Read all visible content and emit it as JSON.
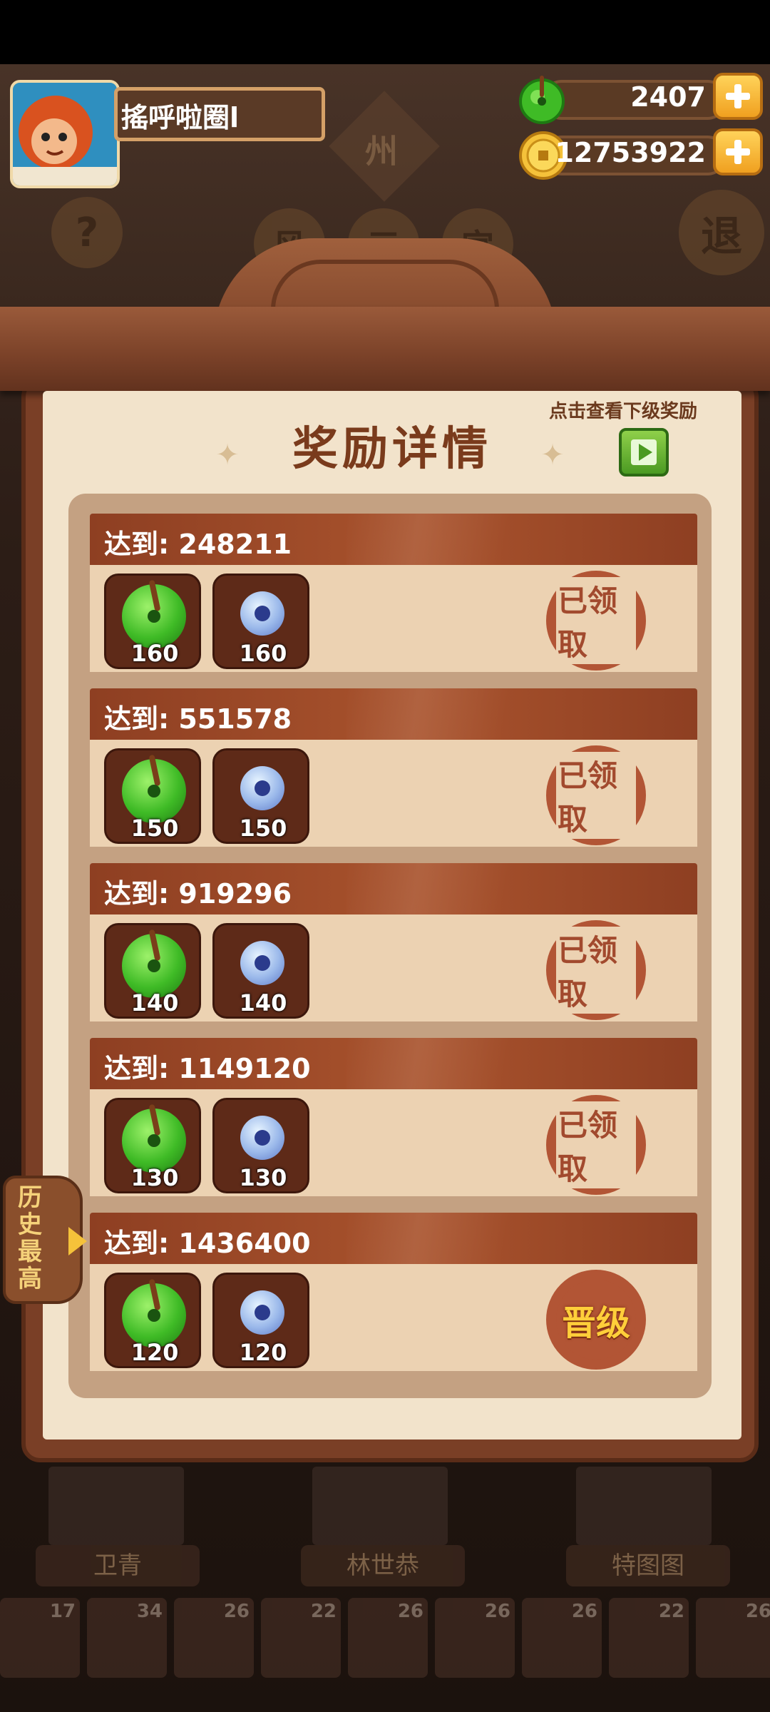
{
  "player": {
    "name": "搖呼啦圈l"
  },
  "currency": {
    "jade": "2407",
    "coins": "12753922"
  },
  "background": {
    "region": "州",
    "help_icon": "?",
    "exit_label": "退",
    "tabs": [
      "风",
      "三",
      "宫"
    ],
    "characters": [
      "卫青",
      "林世恭",
      "特图图"
    ],
    "food_counts": [
      "17",
      "34",
      "26",
      "22",
      "26",
      "26",
      "26",
      "22",
      "26"
    ]
  },
  "panel": {
    "title": "奖励详情",
    "hint": "点击查看下级奖励",
    "side_tab": "历史最高"
  },
  "rewards": [
    {
      "label": "达到: 248211",
      "jade": "160",
      "disc": "160",
      "status": "已领取"
    },
    {
      "label": "达到: 551578",
      "jade": "150",
      "disc": "150",
      "status": "已领取"
    },
    {
      "label": "达到: 919296",
      "jade": "140",
      "disc": "140",
      "status": "已领取"
    },
    {
      "label": "达到: 1149120",
      "jade": "130",
      "disc": "130",
      "status": "已领取"
    },
    {
      "label": "达到: 1436400",
      "jade": "120",
      "disc": "120",
      "status": "晋级"
    }
  ],
  "icons": {
    "jade": "green-jade-pendant-icon",
    "disc": "blue-jade-disc-icon",
    "coin": "gold-coin-icon",
    "plus": "plus-icon",
    "next": "play-arrow-icon"
  },
  "colors": {
    "accent": "#8e3f22",
    "stamp": "#b25535",
    "promo": "#ffcf3a"
  }
}
